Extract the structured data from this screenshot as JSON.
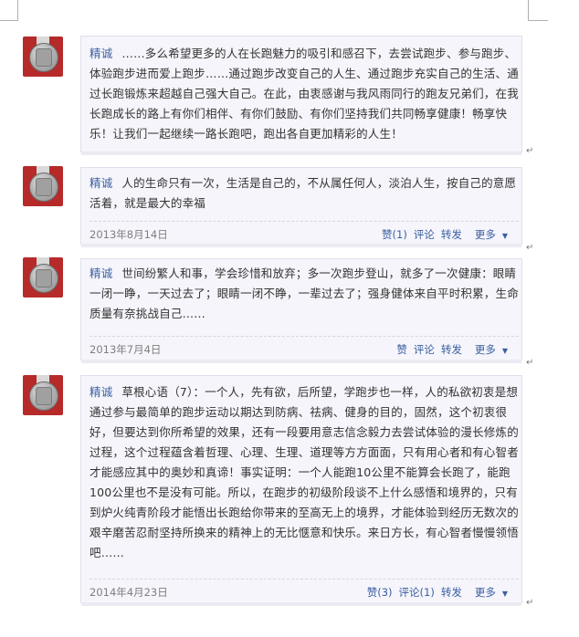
{
  "posts": [
    {
      "user": "精诚",
      "text": "……多么希望更多的人在长跑魅力的吸引和感召下，去尝试跑步、参与跑步、体验跑步进而爱上跑步……通过跑步改变自己的人生、通过跑步充实自己的生活、通过长跑锻炼来超越自己强大自己。在此，由衷感谢与我风雨同行的跑友兄弟们，在我长跑成长的路上有你们相伴、有你们鼓励、有你们坚持我们共同畅享健康！畅享快乐！让我们一起继续一路长跑吧，跑出各自更加精彩的人生！"
    },
    {
      "user": "精诚",
      "text": "人的生命只有一次，生活是自己的，不从属任何人，淡泊人生，按自己的意愿活着，就是最大的幸福",
      "date": "2013年8月14日",
      "like": "赞(1)",
      "comment": "评论",
      "repost": "转发",
      "more": "更多"
    },
    {
      "user": "精诚",
      "text": "世间纷繁人和事，学会珍惜和放弃；多一次跑步登山，就多了一次健康：眼睛一闭一睁，一天过去了；眼睛一闭不睁，一辈过去了；强身健体来自平时积累，生命质量有奈挑战自己……",
      "date": "2013年7月4日",
      "like": "赞",
      "comment": "评论",
      "repost": "转发",
      "more": "更多"
    },
    {
      "user": "精诚",
      "text": "草根心语（7）：一个人，先有欲，后所望，学跑步也一样，人的私欲初衷是想通过参与最简单的跑步运动以期达到防病、祛病、健身的目的，固然，这个初衷很好，但要达到你所希望的效果，还有一段要用意志信念毅力去尝试体验的漫长修炼的过程，这个过程蕴含着哲理、心理、生理、道理等方方面面，只有用心者和有心智者才能感应其中的奥妙和真谛！事实证明：一个人能跑10公里不能算会长跑了，能跑100公里也不是没有可能。所以，在跑步的初级阶段谈不上什么感悟和境界的，只有到炉火纯青阶段才能悟出长跑给你带来的至高无上的境界，才能体验到经历无数次的艰辛磨苦忍耐坚持所换来的精神上的无比惬意和快乐。来日方长，有心智者慢慢领悟吧……",
      "date": "2014年4月23日",
      "like": "赞(3)",
      "comment": "评论(1)",
      "repost": "转发",
      "more": "更多"
    }
  ],
  "icons": {
    "avatar": "silver-medal-on-red",
    "more_caret": "caret-down-icon",
    "paragraph_mark": "↵"
  },
  "colors": {
    "username": "#3b5fa0",
    "card_bg": "#f5f5fb",
    "avatar_bg": "#b62a2a",
    "date": "#808080"
  }
}
